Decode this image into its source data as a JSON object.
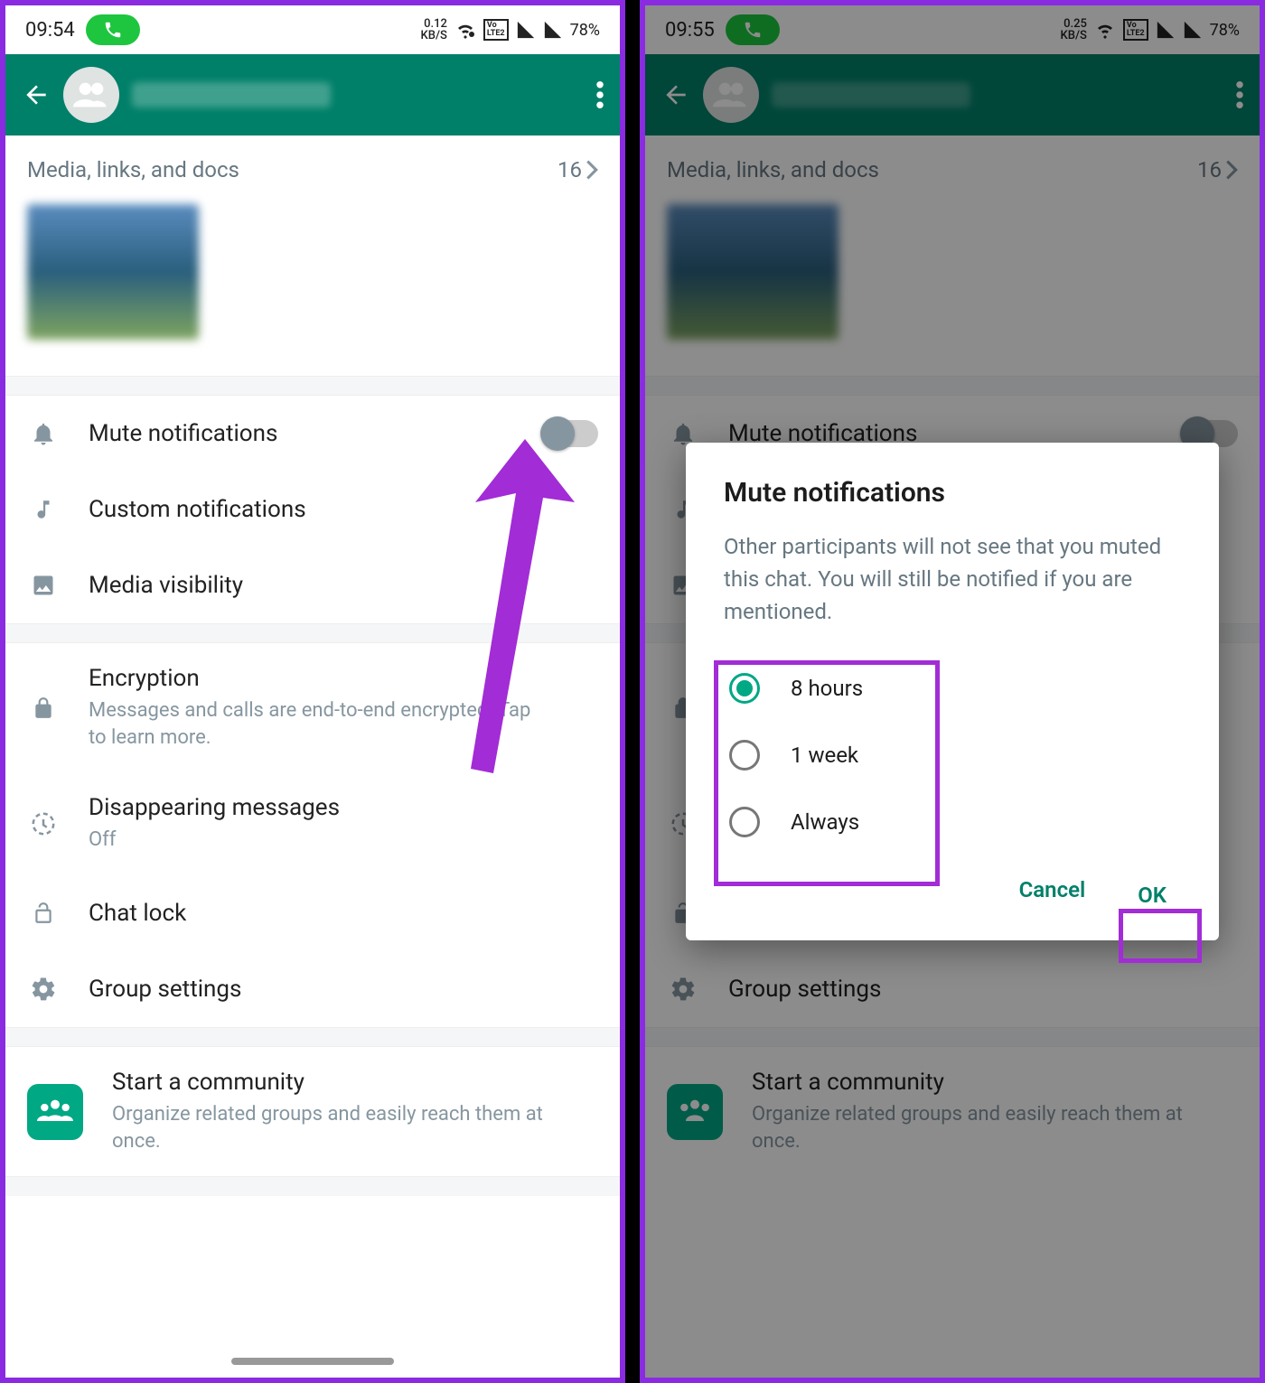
{
  "left": {
    "status": {
      "time": "09:54",
      "kbs_top": "0.12",
      "kbs_bot": "KB/S",
      "lte": "VoLTE2",
      "battery": "78%"
    },
    "media": {
      "title": "Media, links, and docs",
      "count": "16"
    },
    "rows": {
      "mute": "Mute notifications",
      "custom": "Custom notifications",
      "media_vis": "Media visibility",
      "encryption": "Encryption",
      "encryption_sub": "Messages and calls are end-to-end encrypted. Tap to learn more.",
      "disappearing": "Disappearing messages",
      "disappearing_sub": "Off",
      "chatlock": "Chat lock",
      "group_settings": "Group settings",
      "community": "Start a community",
      "community_sub": "Organize related groups and easily reach them at once."
    }
  },
  "right": {
    "status": {
      "time": "09:55",
      "kbs_top": "0.25",
      "kbs_bot": "KB/S",
      "lte": "VoLTE2",
      "battery": "78%"
    },
    "dialog": {
      "title": "Mute notifications",
      "desc": "Other participants will not see that you muted this chat. You will still be notified if you are mentioned.",
      "opt1": "8 hours",
      "opt2": "1 week",
      "opt3": "Always",
      "cancel": "Cancel",
      "ok": "OK"
    }
  }
}
